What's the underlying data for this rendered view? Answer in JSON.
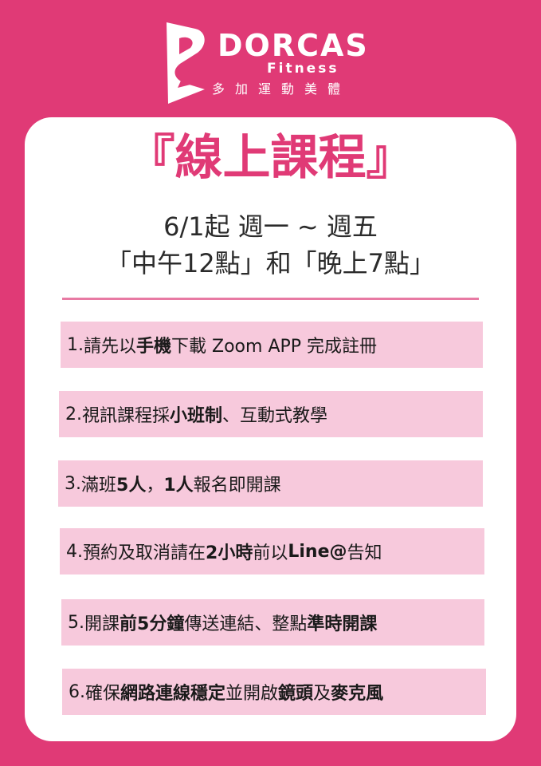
{
  "brand": {
    "name": "DORCAS",
    "sub": "Fitness",
    "tagline": "多加運動美體"
  },
  "title": "『線上課程』",
  "schedule": {
    "line1": "6/1起 週一 ~ 週五",
    "line2": "「中午12點」和「晚上7點」"
  },
  "rules": [
    {
      "num": "1.",
      "parts": [
        {
          "text": "請先以"
        },
        {
          "text": "手機",
          "bold": true
        },
        {
          "text": "下載 Zoom APP 完成註冊"
        }
      ]
    },
    {
      "num": "2.",
      "parts": [
        {
          "text": "視訊課程採"
        },
        {
          "text": "小班制",
          "bold": true
        },
        {
          "text": "、互動式教學"
        }
      ]
    },
    {
      "num": "3.",
      "parts": [
        {
          "text": "滿班"
        },
        {
          "text": "5人",
          "bold": true
        },
        {
          "text": "，"
        },
        {
          "text": "1人",
          "bold": true
        },
        {
          "text": "報名即開課"
        }
      ]
    },
    {
      "num": "4.",
      "parts": [
        {
          "text": "預約及取消請在"
        },
        {
          "text": "2小時",
          "bold": true
        },
        {
          "text": "前以"
        },
        {
          "text": "Line@",
          "bold": true
        },
        {
          "text": "告知"
        }
      ]
    },
    {
      "num": "5.",
      "parts": [
        {
          "text": "開課"
        },
        {
          "text": "前5分鐘",
          "bold": true
        },
        {
          "text": "傳送連結、整點"
        },
        {
          "text": "準時開課",
          "bold": true
        }
      ]
    },
    {
      "num": "6.",
      "parts": [
        {
          "text": "確保"
        },
        {
          "text": "網路連線穩定",
          "bold": true
        },
        {
          "text": "並開啟"
        },
        {
          "text": "鏡頭",
          "bold": true
        },
        {
          "text": "及"
        },
        {
          "text": "麥克風",
          "bold": true
        }
      ]
    }
  ],
  "colors": {
    "background": "#e03a76",
    "card": "#ffffff",
    "rule_bg": "#f7c9dc",
    "accent": "#e03a76"
  }
}
